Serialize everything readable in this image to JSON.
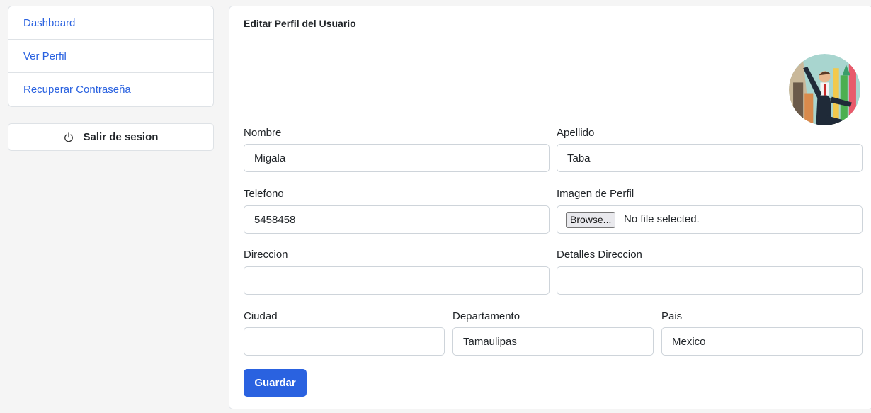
{
  "sidebar": {
    "items": [
      {
        "label": "Dashboard"
      },
      {
        "label": "Ver Perfil"
      },
      {
        "label": "Recuperar Contraseña"
      }
    ],
    "logout_label": "Salir de sesion",
    "logout_icon": "power-icon"
  },
  "card": {
    "title": "Editar Perfil del Usuario"
  },
  "form": {
    "nombre": {
      "label": "Nombre",
      "value": "Migala"
    },
    "apellido": {
      "label": "Apellido",
      "value": "Taba"
    },
    "telefono": {
      "label": "Telefono",
      "value": "5458458"
    },
    "imagen": {
      "label": "Imagen de Perfil",
      "button": "Browse...",
      "status": "No file selected."
    },
    "direccion": {
      "label": "Direccion",
      "value": ""
    },
    "detalles": {
      "label": "Detalles Direccion",
      "value": ""
    },
    "ciudad": {
      "label": "Ciudad",
      "value": ""
    },
    "departamento": {
      "label": "Departamento",
      "value": "Tamaulipas"
    },
    "pais": {
      "label": "Pais",
      "value": "Mexico"
    },
    "save_label": "Guardar"
  },
  "colors": {
    "accent": "#2a62e0",
    "background": "#f5f5f5",
    "border": "#dee2e6"
  }
}
